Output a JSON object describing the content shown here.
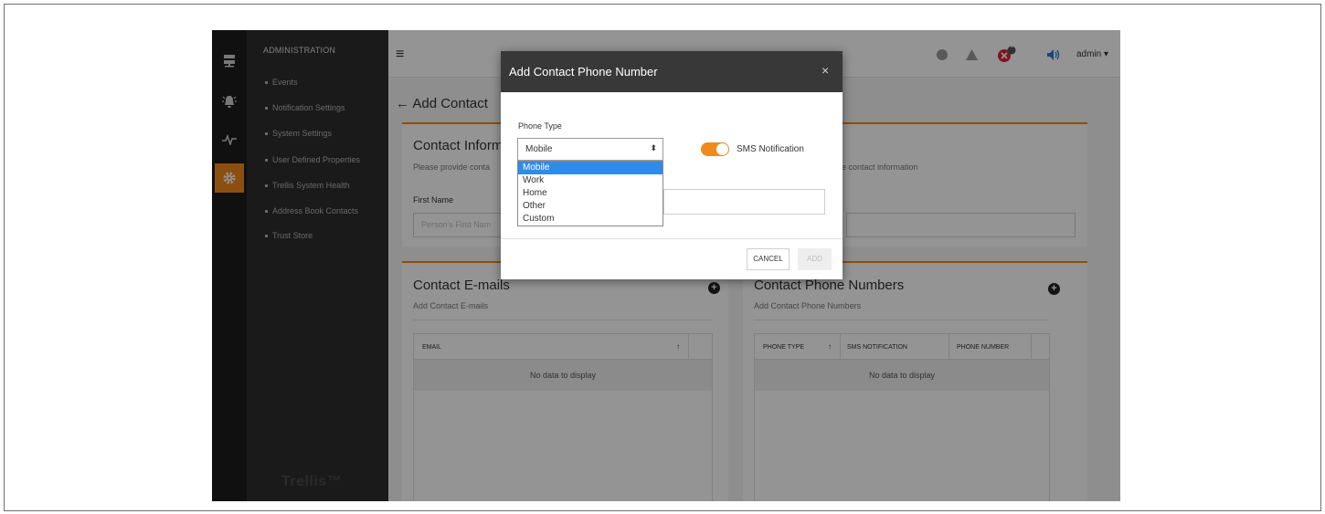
{
  "sidebar": {
    "heading": "ADMINISTRATION",
    "items": [
      {
        "label": "Events"
      },
      {
        "label": "Notification Settings"
      },
      {
        "label": "System Settings"
      },
      {
        "label": "User Defined Properties"
      },
      {
        "label": "Trellis System Health"
      },
      {
        "label": "Address Book Contacts"
      },
      {
        "label": "Trust Store"
      }
    ],
    "brand": "Trellis™",
    "rail_icons": [
      "server-icon",
      "alarm-bell-icon",
      "pulse-icon",
      "gear-icon"
    ]
  },
  "header": {
    "user": "admin",
    "alert_badge_count": "2",
    "accent_color": "#f08a1d",
    "alert_color": "#e0203a"
  },
  "page": {
    "back_title": "Add Contact",
    "contact_info_title": "Contact Inform",
    "contact_info_subtitle_left": "Please provide conta",
    "contact_info_subtitle_right": "e contact information",
    "first_name_label": "First Name",
    "first_name_placeholder": "Person's First Nam",
    "emails": {
      "title": "Contact E-mails",
      "subtitle": "Add Contact E-mails",
      "columns": [
        "EMAIL"
      ],
      "sort_indicator": "↑",
      "empty_text": "No data to display"
    },
    "phones": {
      "title": "Contact Phone Numbers",
      "subtitle": "Add Contact Phone Numbers",
      "columns": [
        "PHONE TYPE",
        "SMS NOTIFICATION",
        "PHONE NUMBER"
      ],
      "sort_indicator": "↑",
      "empty_text": "No data to display"
    }
  },
  "dialog": {
    "title": "Add Contact Phone Number",
    "close_glyph": "×",
    "phone_type_label": "Phone Type",
    "phone_type_value": "Mobile",
    "sms_label": "SMS Notification",
    "sms_enabled": true,
    "cancel_label": "CANCEL",
    "add_label": "ADD",
    "options": [
      "Mobile",
      "Work",
      "Home",
      "Other",
      "Custom"
    ],
    "selected_option": "Mobile"
  }
}
